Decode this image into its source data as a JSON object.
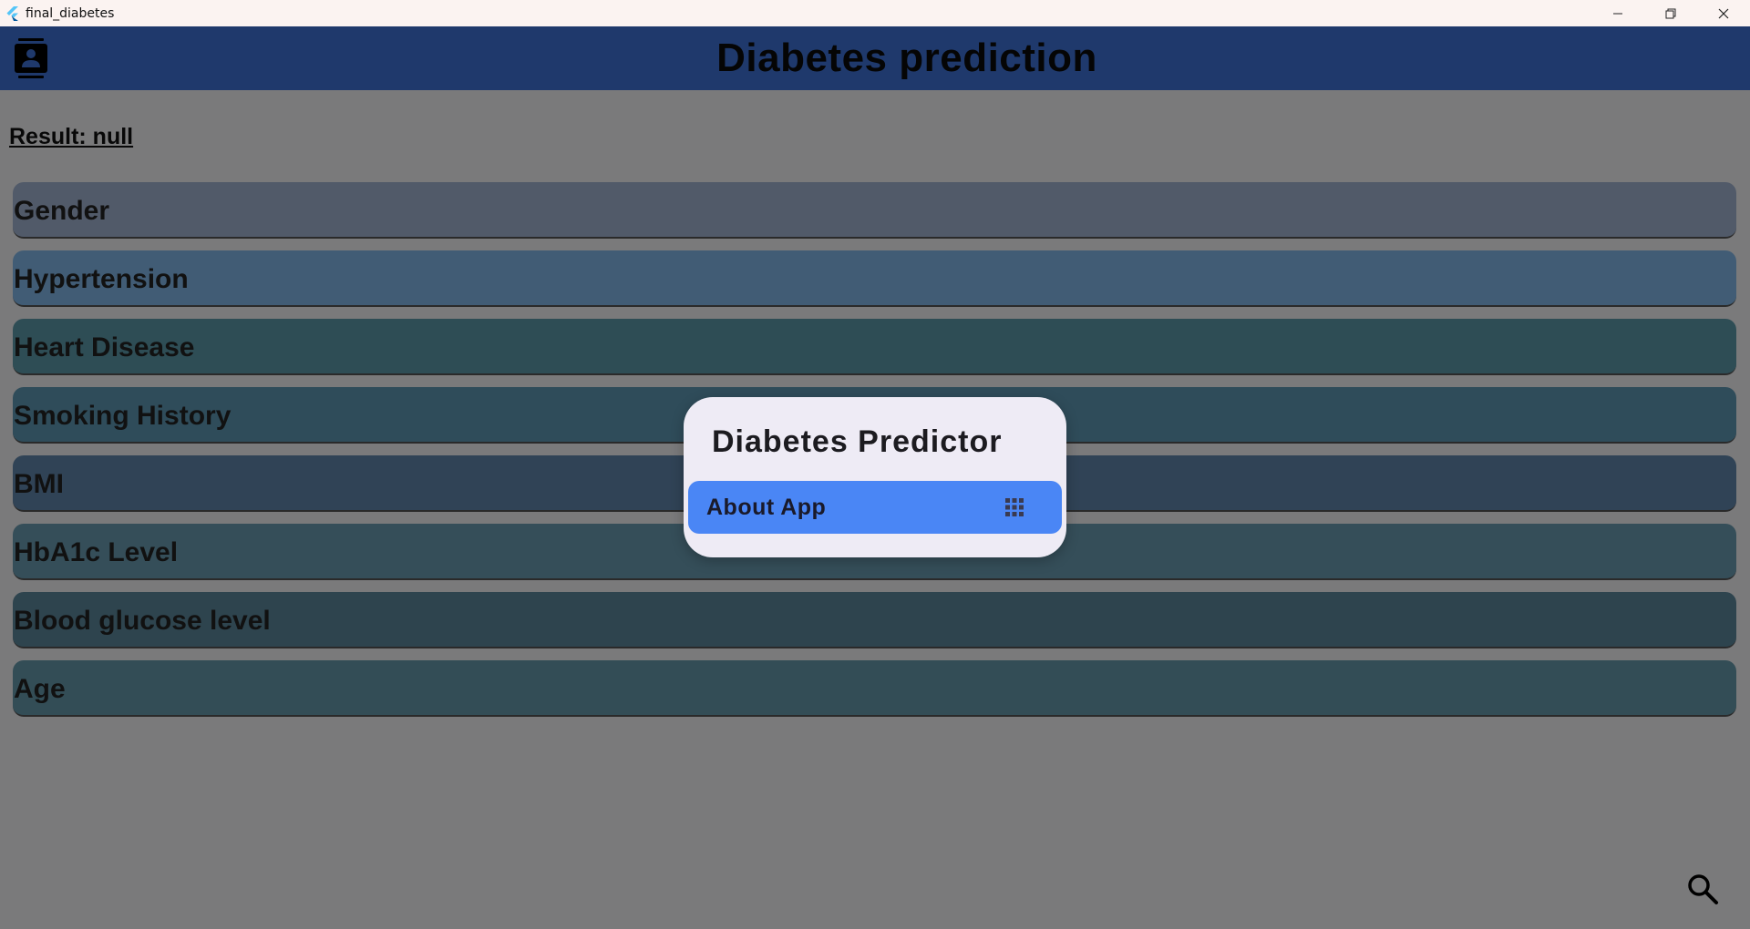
{
  "window": {
    "title": "final_diabetes",
    "icon": "flutter-logo-icon",
    "controls": [
      "minimize-icon",
      "restore-icon",
      "close-icon"
    ]
  },
  "appbar": {
    "title": "Diabetes prediction",
    "leading_icon": "contact-card-icon"
  },
  "result_text": "Result: null",
  "fields": [
    {
      "label": "Gender",
      "color": "#a3b4d3"
    },
    {
      "label": "Hypertension",
      "color": "#82b9ea"
    },
    {
      "label": "Heart Disease",
      "color": "#5c9bab"
    },
    {
      "label": "Smoking History",
      "color": "#5e98b5"
    },
    {
      "label": "BMI",
      "color": "#6087ad"
    },
    {
      "label": "HbA1c Level",
      "color": "#6a9cb2"
    },
    {
      "label": "Blood glucose level",
      "color": "#5c889d"
    },
    {
      "label": "Age",
      "color": "#669aad"
    }
  ],
  "fab_icon": "search-icon",
  "dialog": {
    "title": "Diabetes Predictor",
    "about_button": "About App",
    "about_icon": "apps-grid-icon"
  },
  "colors": {
    "appbar": "#3f73d9",
    "about_button": "#4a86f5",
    "dialog_bg": "#eeebf5"
  }
}
